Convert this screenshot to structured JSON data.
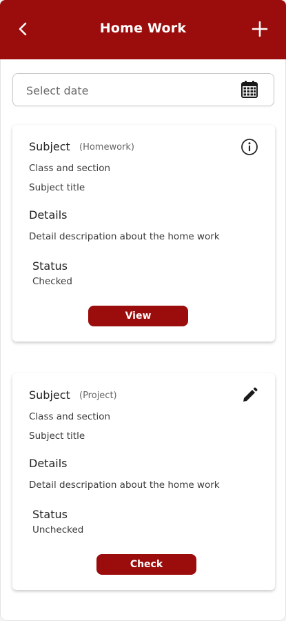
{
  "appbar": {
    "title": "Home Work",
    "back_icon": "back-chevron-icon",
    "add_icon": "plus-icon",
    "color": "#9b0c0c"
  },
  "date_field": {
    "placeholder": "Select date",
    "icon": "calendar-icon"
  },
  "cards": [
    {
      "subject_label": "Subject",
      "type": "(Homework)",
      "class_section": "Class and section",
      "subject_title": "Subject title",
      "details_label": "Details",
      "details_text": "Detail descripation about the home work",
      "status_label": "Status",
      "status_value": "Checked",
      "action_icon": "info-icon",
      "button_label": "View"
    },
    {
      "subject_label": "Subject",
      "type": "(Project)",
      "class_section": "Class and section",
      "subject_title": "Subject title",
      "details_label": "Details",
      "details_text": "Detail descripation about the home work",
      "status_label": "Status",
      "status_value": "Unchecked",
      "action_icon": "pencil-edit-icon",
      "button_label": "Check"
    }
  ]
}
